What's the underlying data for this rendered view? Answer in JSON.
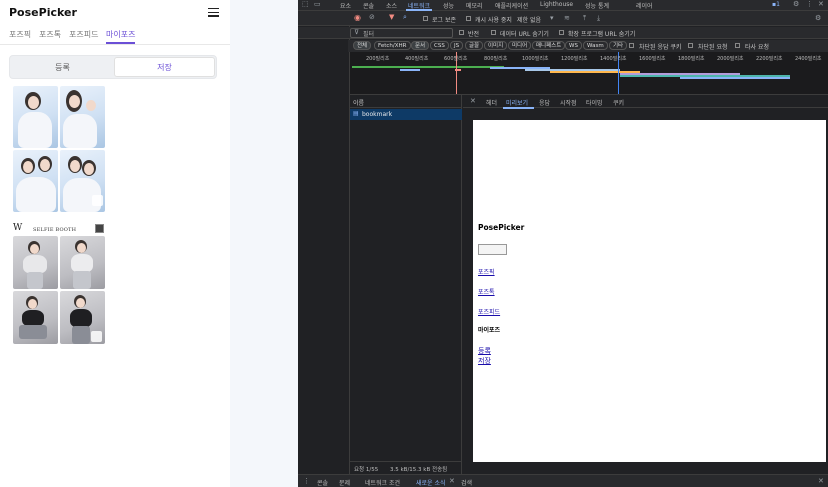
{
  "app": {
    "title": "PosePicker",
    "nav": [
      "포즈픽",
      "포즈톡",
      "포즈피드",
      "마이포즈"
    ],
    "segment": {
      "register": "등록",
      "save": "저장"
    },
    "strip_text": "SELFIE BOOTH",
    "strip_logo": "W",
    "colors": {
      "accent": "#6b4fd6"
    }
  },
  "devtools": {
    "top_tabs": [
      "요소",
      "콘솔",
      "소스",
      "네트워크",
      "성능",
      "메모리",
      "애플리케이션",
      "Lighthouse",
      "성능 통계",
      "레이어"
    ],
    "issues_count": "1",
    "search_label": "검색",
    "toolbar": {
      "preserve_log": "로그 보존",
      "disable_cache": "캐시 사용 중지",
      "throttle": "제한 없음"
    },
    "filter_placeholder": "필터",
    "filter_options": {
      "invert": "반전",
      "hide_data_urls": "데이터 URL 숨기기",
      "hide_ext_urls": "확장 프로그램 URL 숨기기"
    },
    "type_chips": [
      "전체",
      "Fetch/XHR",
      "문서",
      "CSS",
      "JS",
      "글꼴",
      "이미지",
      "미디어",
      "매니페스트",
      "WS",
      "Wasm",
      "기타"
    ],
    "type_options": {
      "blocked_cookies": "차단된 응답 쿠키",
      "blocked_requests": "차단된 요청",
      "third_party": "타사 요청"
    },
    "timeline_ticks": [
      "200밀리초",
      "400밀리초",
      "600밀리초",
      "800밀리초",
      "1000밀리초",
      "1200밀리초",
      "1400밀리초",
      "1600밀리초",
      "1800밀리초",
      "2000밀리초",
      "2200밀리초",
      "2400밀리초"
    ],
    "name_header": "이름",
    "request": "bookmark",
    "detail_tabs": [
      "헤더",
      "미리보기",
      "응답",
      "시작점",
      "타이밍",
      "쿠키"
    ],
    "preview": {
      "title": "PosePicker",
      "links": [
        "포즈픽",
        "포즈톡",
        "포즈피드"
      ],
      "mypose": "마이포즈",
      "actions": [
        "등록",
        "저장"
      ]
    },
    "status": {
      "requests": "요청 1/55",
      "transferred": "3.5 kB/15.3 kB 전송됨"
    },
    "drawer_tabs": [
      "콘솔",
      "문제",
      "네트워크 조건",
      "새로운 소식",
      "검색"
    ]
  }
}
